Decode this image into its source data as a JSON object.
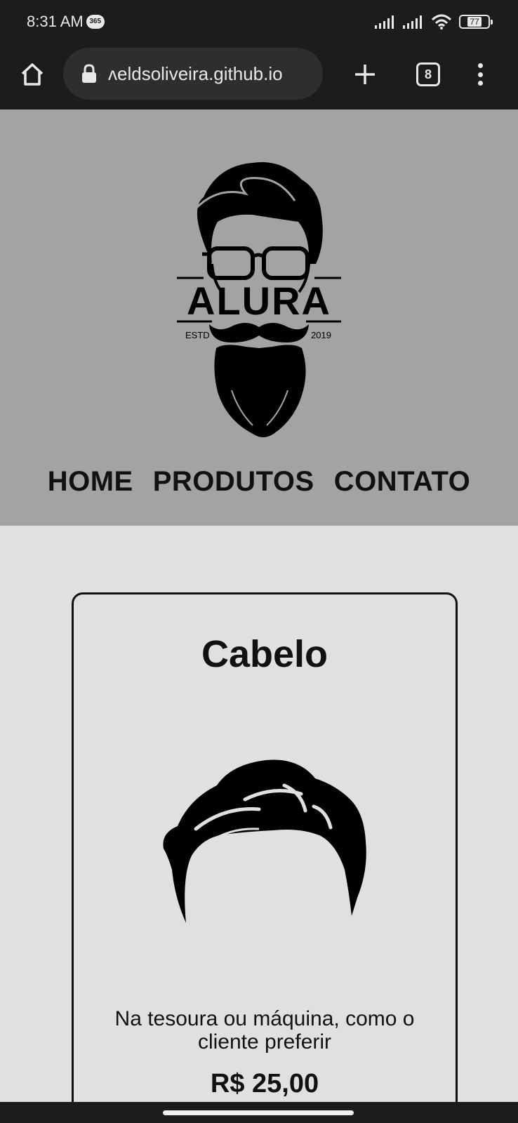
{
  "status_bar": {
    "time": "8:31 AM",
    "badge": "365",
    "battery": "77"
  },
  "browser": {
    "url": "ʌeldsoliveira.github.io",
    "tab_count": "8",
    "icons": [
      "home-icon",
      "lock-icon",
      "plus-icon",
      "tabs-icon",
      "more-vert-icon"
    ]
  },
  "header": {
    "logo_icon": "alura-barber-logo",
    "logo_text": "ALURA",
    "logo_left": "ESTD",
    "logo_right": "2019",
    "nav": [
      "HOME",
      "PRODUTOS",
      "CONTATO"
    ]
  },
  "card": {
    "title": "Cabelo",
    "image_icon": "hair-icon",
    "description": "Na tesoura ou máquina, como o cliente preferir",
    "price": "R$ 25,00"
  },
  "colors": {
    "chrome_bg": "#1c1c1c",
    "header_bg": "#a3a3a3",
    "page_bg": "#e0e0e0",
    "text": "#111111"
  }
}
